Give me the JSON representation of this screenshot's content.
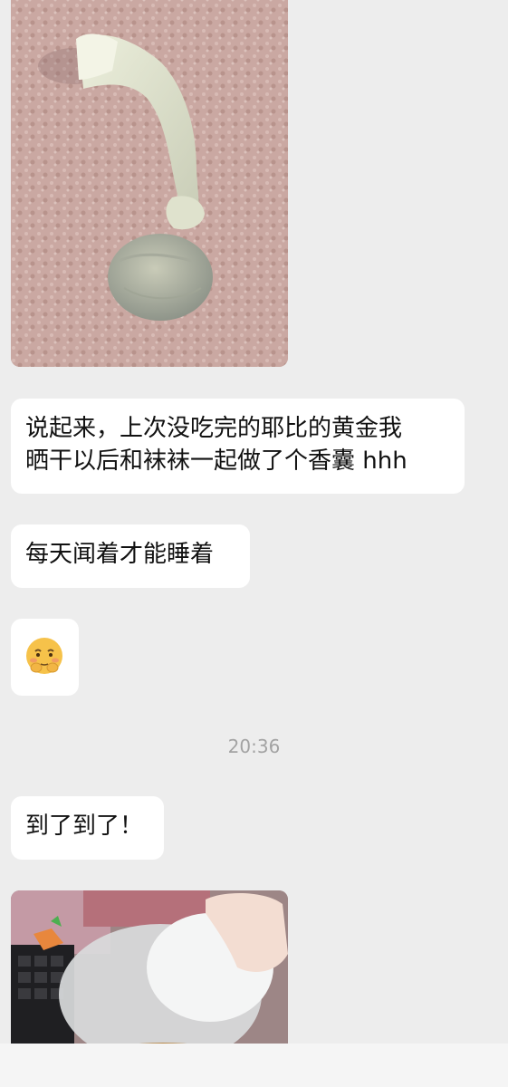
{
  "messages": [
    {
      "type": "image",
      "description": "knotted light-green sock sachet on pink fuzzy blanket"
    },
    {
      "type": "text",
      "lines": [
        "说起来，上次没吃完的耶比的黄金我",
        "晒干以后和袜袜一起做了个香囊 hhh"
      ]
    },
    {
      "type": "text",
      "text": "每天闻着才能睡着"
    },
    {
      "type": "emoji",
      "name": "pleading-face-emoji"
    },
    {
      "type": "text",
      "text": "到了到了！"
    },
    {
      "type": "image",
      "description": "hand holding clear plastic container lid"
    }
  ],
  "timestamp": "20:36",
  "colors": {
    "background": "#ededed",
    "bubble": "#ffffff",
    "timestamp": "#a3a3a3"
  }
}
